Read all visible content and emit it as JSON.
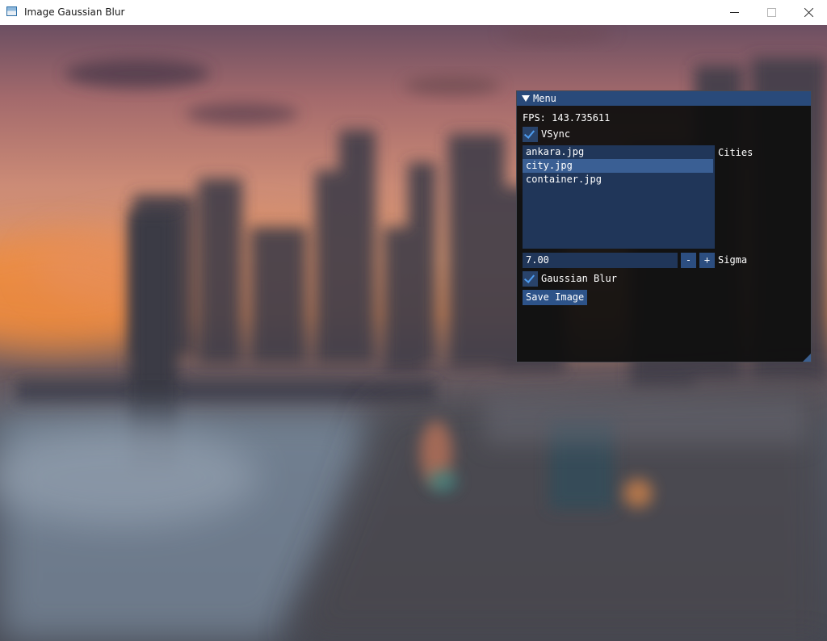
{
  "window": {
    "title": "Image Gaussian Blur",
    "icon": "app-window-icon",
    "controls": [
      "minimize-icon",
      "maximize-icon",
      "close-icon"
    ]
  },
  "panel": {
    "title": "Menu",
    "fps_text": "FPS: 143.735611",
    "vsync": {
      "label": "VSync",
      "checked": true
    },
    "cities": {
      "label": "Cities",
      "items": [
        "ankara.jpg",
        "city.jpg",
        "container.jpg"
      ],
      "selected": "city.jpg"
    },
    "sigma": {
      "label": "Sigma",
      "value": "7.00",
      "decrement": "-",
      "increment": "+"
    },
    "gaussian_blur": {
      "label": "Gaussian Blur",
      "checked": true
    },
    "save_label": "Save Image"
  },
  "colors": {
    "panel_header": "#294a7a",
    "frame_bg": "#203659",
    "button": "#2d5389",
    "checkmark": "#4f9df0",
    "selected_item": "#3a5f94"
  }
}
